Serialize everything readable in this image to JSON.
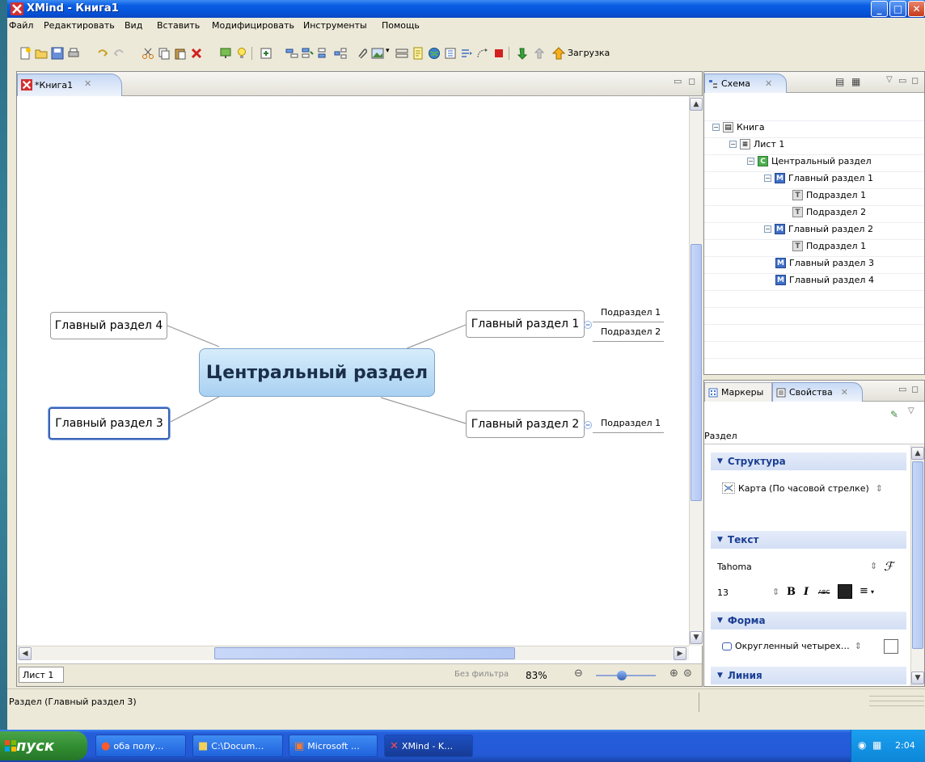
{
  "window": {
    "title": "XMind - Книга1"
  },
  "menu": [
    "Файл",
    "Редактировать",
    "Вид",
    "Вставить",
    "Модифицировать",
    "Инструменты",
    "Помощь"
  ],
  "toolbar": {
    "download_label": "Загрузка"
  },
  "editor": {
    "tab_label": "*Книга1",
    "central": "Центральный раздел",
    "topics": {
      "main1": "Главный раздел 1",
      "main2": "Главный раздел 2",
      "main3": "Главный раздел 3",
      "main4": "Главный раздел 4"
    },
    "subtopics": {
      "m1s1": "Подраздел 1",
      "m1s2": "Подраздел 2",
      "m2s1": "Подраздел 1"
    },
    "sheet_tab": "Лист 1",
    "filter_label": "Без фильтра",
    "zoom": "83%"
  },
  "outline": {
    "tab_label": "Схема",
    "rows": [
      {
        "icon": "workbook",
        "label": "Книга"
      },
      {
        "icon": "sheet",
        "label": "Лист 1"
      },
      {
        "icon": "C",
        "label": "Центральный раздел"
      },
      {
        "icon": "M",
        "label": "Главный раздел 1"
      },
      {
        "icon": "T",
        "label": "Подраздел 1"
      },
      {
        "icon": "T",
        "label": "Подраздел 2"
      },
      {
        "icon": "M",
        "label": "Главный раздел 2"
      },
      {
        "icon": "T",
        "label": "Подраздел 1"
      },
      {
        "icon": "M",
        "label": "Главный раздел 3"
      },
      {
        "icon": "M",
        "label": "Главный раздел 4"
      }
    ]
  },
  "properties": {
    "markers_tab": "Маркеры",
    "props_tab": "Свойства",
    "object_type": "Раздел",
    "structure_header": "Структура",
    "structure_value": "Карта (По часовой стрелке)",
    "text_header": "Текст",
    "font_name": "Tahoma",
    "font_size": "13",
    "bold": "B",
    "italic": "I",
    "strike": "ABC",
    "shape_header": "Форма",
    "shape_value": "Округленный четырех…",
    "line_header": "Линия"
  },
  "status": {
    "text": "Раздел (Главный раздел 3)"
  },
  "taskbar": {
    "start": "пуск",
    "tasks": [
      "оба полу…",
      "C:\\Docum…",
      "Microsoft …",
      "XMind - K…"
    ],
    "clock": "2:04"
  },
  "colors": {
    "accent": "#3a62b6",
    "central_fill": "#a9d1f2",
    "title_bar": "#0553d8"
  }
}
